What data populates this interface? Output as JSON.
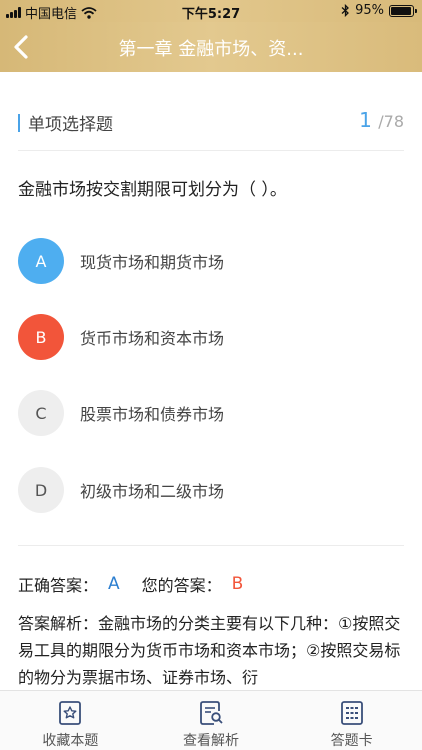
{
  "status_bar": {
    "carrier": "中国电信",
    "time": "下午5:27",
    "battery": "95%",
    "battery_level": 0.95
  },
  "nav": {
    "title": "第一章 金融市场、资..."
  },
  "question_header": {
    "type_label": "单项选择题",
    "current": "1",
    "total": "/78"
  },
  "question": {
    "text": "金融市场按交割期限可划分为（ ）。",
    "options": [
      {
        "letter": "A",
        "text": "现货市场和期货市场",
        "state": "correct"
      },
      {
        "letter": "B",
        "text": "货币市场和资本市场",
        "state": "wrong"
      },
      {
        "letter": "C",
        "text": "股票市场和债券市场",
        "state": "normal"
      },
      {
        "letter": "D",
        "text": "初级市场和二级市场",
        "state": "normal"
      }
    ]
  },
  "answers": {
    "correct_label": "正确答案：",
    "correct_value": "A",
    "your_label": "您的答案：",
    "your_value": "B"
  },
  "analysis": {
    "text": "答案解析：金融市场的分类主要有以下几种：①按照交易工具的期限分为货币市场和资本市场；②按照交易标的物分为票据市场、证券市场、衍"
  },
  "tabbar": {
    "items": [
      {
        "label": "收藏本题"
      },
      {
        "label": "查看解析"
      },
      {
        "label": "答题卡"
      }
    ]
  },
  "colors": {
    "header_gold": "#d6b877",
    "accent_blue": "#4aa3e8",
    "correct_blue": "#4eaef0",
    "wrong_red": "#f2553a",
    "tab_icon": "#3a4f7a"
  }
}
